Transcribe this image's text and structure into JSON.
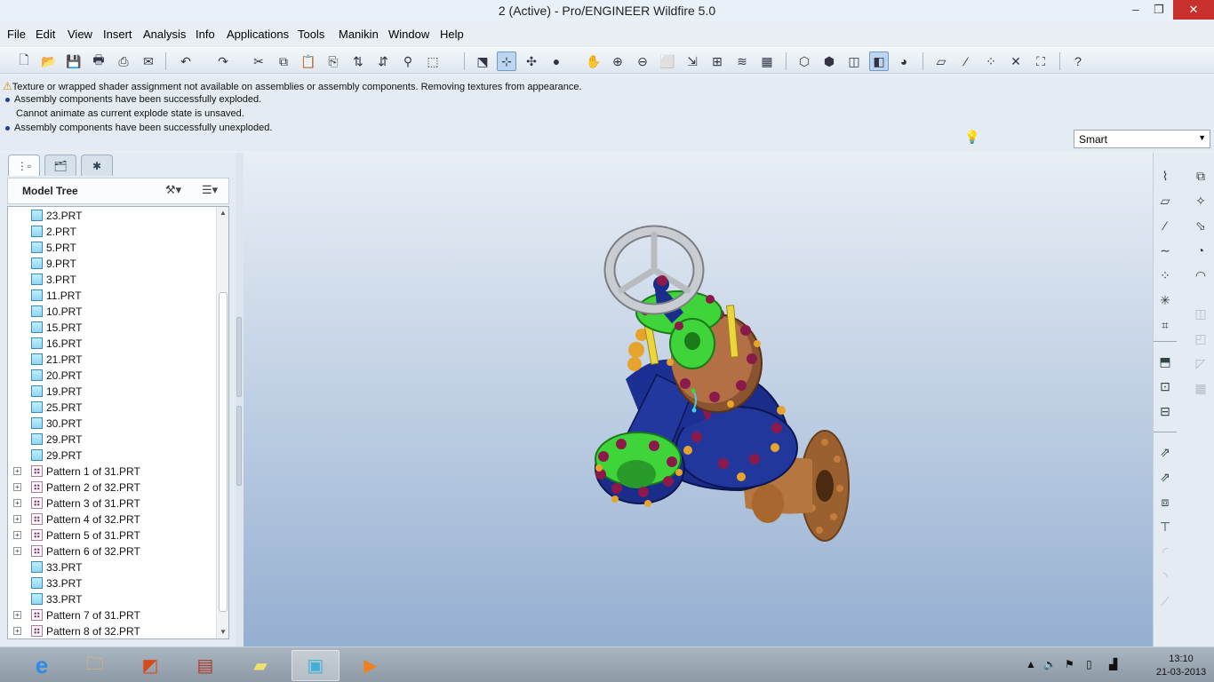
{
  "window": {
    "title": "2 (Active) - Pro/ENGINEER Wildfire 5.0",
    "minimize": "–",
    "restore": "❐",
    "close": "✕"
  },
  "menu": [
    "File",
    "Edit",
    "View",
    "Insert",
    "Analysis",
    "Info",
    "Applications",
    "Tools",
    "Manikin",
    "Window",
    "Help"
  ],
  "messages": {
    "line1": "Texture or wrapped shader assignment not available on assemblies or assembly components. Removing textures from appearance.",
    "line2": "Assembly components have been successfully exploded.",
    "line3": "Cannot animate as current explode state is unsaved.",
    "line4": "Assembly components have been successfully unexploded."
  },
  "filter": {
    "selected": "Smart"
  },
  "model_tree": {
    "title": "Model Tree",
    "items": [
      {
        "label": "23.PRT",
        "type": "part"
      },
      {
        "label": "2.PRT",
        "type": "part"
      },
      {
        "label": "5.PRT",
        "type": "part"
      },
      {
        "label": "9.PRT",
        "type": "part"
      },
      {
        "label": "3.PRT",
        "type": "part"
      },
      {
        "label": "11.PRT",
        "type": "part"
      },
      {
        "label": "10.PRT",
        "type": "part"
      },
      {
        "label": "15.PRT",
        "type": "part"
      },
      {
        "label": "16.PRT",
        "type": "part"
      },
      {
        "label": "21.PRT",
        "type": "part"
      },
      {
        "label": "20.PRT",
        "type": "part"
      },
      {
        "label": "19.PRT",
        "type": "part"
      },
      {
        "label": "25.PRT",
        "type": "part"
      },
      {
        "label": "30.PRT",
        "type": "part"
      },
      {
        "label": "29.PRT",
        "type": "part"
      },
      {
        "label": "29.PRT",
        "type": "part"
      },
      {
        "label": "Pattern 1 of 31.PRT",
        "type": "pattern"
      },
      {
        "label": "Pattern 2 of 32.PRT",
        "type": "pattern"
      },
      {
        "label": "Pattern 3 of 31.PRT",
        "type": "pattern"
      },
      {
        "label": "Pattern 4 of 32.PRT",
        "type": "pattern"
      },
      {
        "label": "Pattern 5 of 31.PRT",
        "type": "pattern"
      },
      {
        "label": "Pattern 6 of 32.PRT",
        "type": "pattern"
      },
      {
        "label": "33.PRT",
        "type": "part"
      },
      {
        "label": "33.PRT",
        "type": "part"
      },
      {
        "label": "33.PRT",
        "type": "part"
      },
      {
        "label": "Pattern 7 of 31.PRT",
        "type": "pattern"
      },
      {
        "label": "Pattern 8 of 32.PRT",
        "type": "pattern"
      }
    ]
  },
  "clock": {
    "time": "13:10",
    "date": "21-03-2013"
  }
}
